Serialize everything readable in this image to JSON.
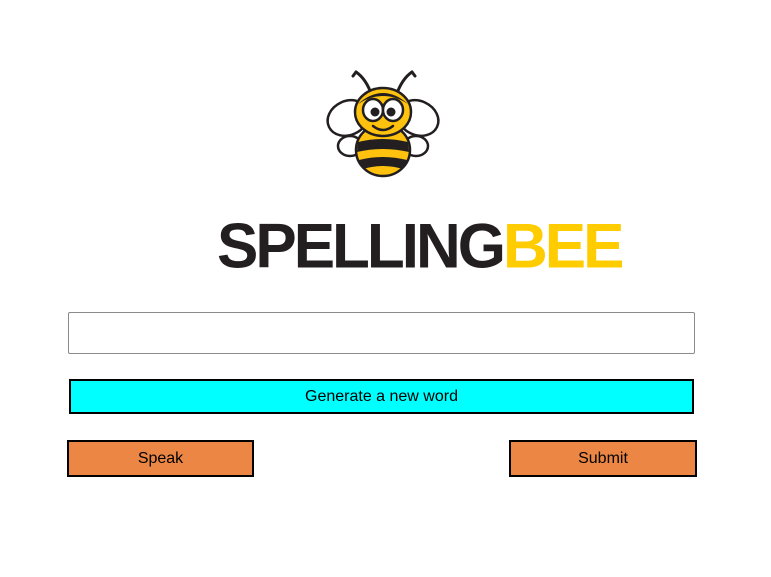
{
  "logo": {
    "icon": "bee-icon",
    "title_part1": "SPELLING",
    "title_part2": "BEE",
    "colors": {
      "dark": "#231f20",
      "yellow": "#ffcc00"
    }
  },
  "word_input": {
    "value": "",
    "placeholder": ""
  },
  "buttons": {
    "generate_label": "Generate a new word",
    "speak_label": "Speak",
    "submit_label": "Submit"
  },
  "colors": {
    "generate_bg": "#00ffff",
    "action_bg": "#eb8644"
  }
}
